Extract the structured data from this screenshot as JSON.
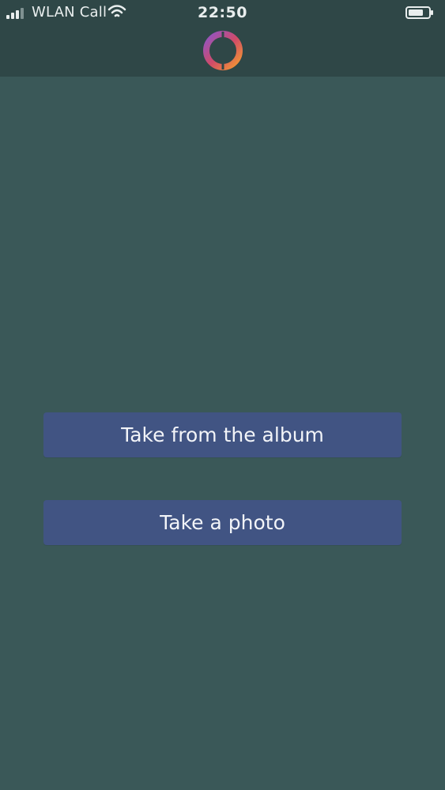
{
  "status_bar": {
    "carrier": "WLAN Call",
    "time": "22:50",
    "signal_icon": "signal-bars-icon",
    "wifi_icon": "wifi-icon",
    "battery_icon": "battery-icon"
  },
  "header": {
    "logo_icon": "app-logo-ring-icon"
  },
  "actions": {
    "album_label": "Take from the album",
    "photo_label": "Take a photo"
  },
  "colors": {
    "status_bar_bg": "#2f4747",
    "screen_bg": "#3a5858",
    "button_bg": "#415483",
    "button_text": "#f2f4f8",
    "logo_gradient": [
      "#8f55c8",
      "#d04b68",
      "#f59b2f"
    ]
  }
}
